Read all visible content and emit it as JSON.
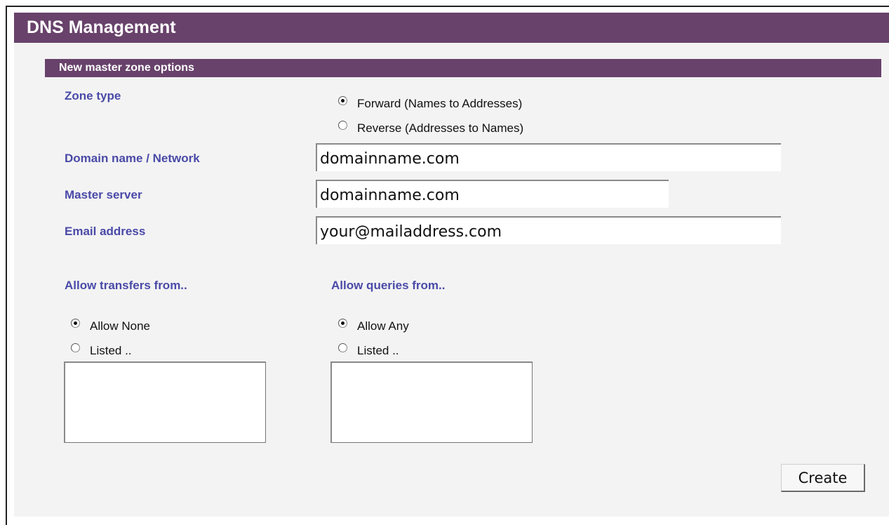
{
  "header": {
    "title": "DNS Management"
  },
  "section": {
    "title": "New master zone options"
  },
  "zone_type": {
    "label": "Zone type",
    "options": [
      {
        "label": "Forward (Names to Addresses)",
        "checked": true
      },
      {
        "label": "Reverse (Addresses to Names)",
        "checked": false
      }
    ]
  },
  "domain": {
    "label": "Domain name / Network",
    "value": "domainname.com"
  },
  "master_server": {
    "label": "Master server",
    "value": "domainname.com"
  },
  "email": {
    "label": "Email address",
    "value": "your@mailaddress.com"
  },
  "transfers": {
    "label": "Allow transfers from..",
    "options": [
      {
        "label": "Allow None",
        "checked": true
      },
      {
        "label": "Listed ..",
        "checked": false
      }
    ]
  },
  "queries": {
    "label": "Allow queries from..",
    "options": [
      {
        "label": "Allow Any",
        "checked": true
      },
      {
        "label": "Listed ..",
        "checked": false
      }
    ]
  },
  "actions": {
    "create_label": "Create"
  }
}
